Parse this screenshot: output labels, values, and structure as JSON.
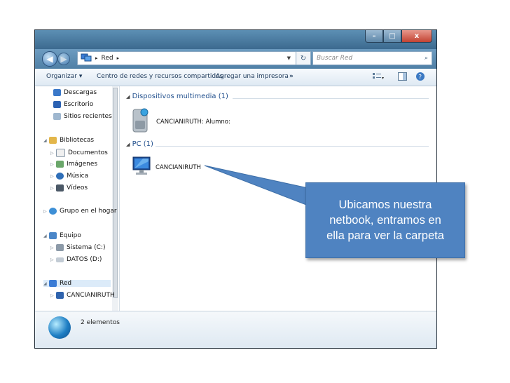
{
  "window": {
    "title_buttons": {
      "minimize": "–",
      "maximize": "□",
      "close": "x"
    }
  },
  "address_bar": {
    "breadcrumb": "Red",
    "search_placeholder": "Buscar Red"
  },
  "toolbar": {
    "organize": "Organizar",
    "network_center": "Centro de redes y recursos compartidos",
    "add_printer": "Agregar una impresora",
    "more": "»"
  },
  "nav_pane": {
    "favorites": [
      "Descargas",
      "Escritorio",
      "Sitios recientes"
    ],
    "libraries_header": "Bibliotecas",
    "libraries": [
      "Documentos",
      "Imágenes",
      "Música",
      "Vídeos"
    ],
    "homegroup": "Grupo en el hogar",
    "computer_header": "Equipo",
    "drives": [
      "Sistema (C:)",
      "DATOS (D:)"
    ],
    "network_header": "Red",
    "network_items": [
      "CANCIANIRUTH"
    ]
  },
  "main_pane": {
    "groups": [
      {
        "label": "Dispositivos multimedia (1)",
        "items": [
          "CANCIANIRUTH: Alumno:"
        ]
      },
      {
        "label": "PC (1)",
        "items": [
          "CANCIANIRUTH"
        ]
      }
    ]
  },
  "status_bar": {
    "text": "2 elementos"
  },
  "callout": {
    "lines": [
      "Ubicamos nuestra",
      "netbook, entramos en",
      "ella para ver la carpeta"
    ],
    "color": "#4f83c1"
  }
}
